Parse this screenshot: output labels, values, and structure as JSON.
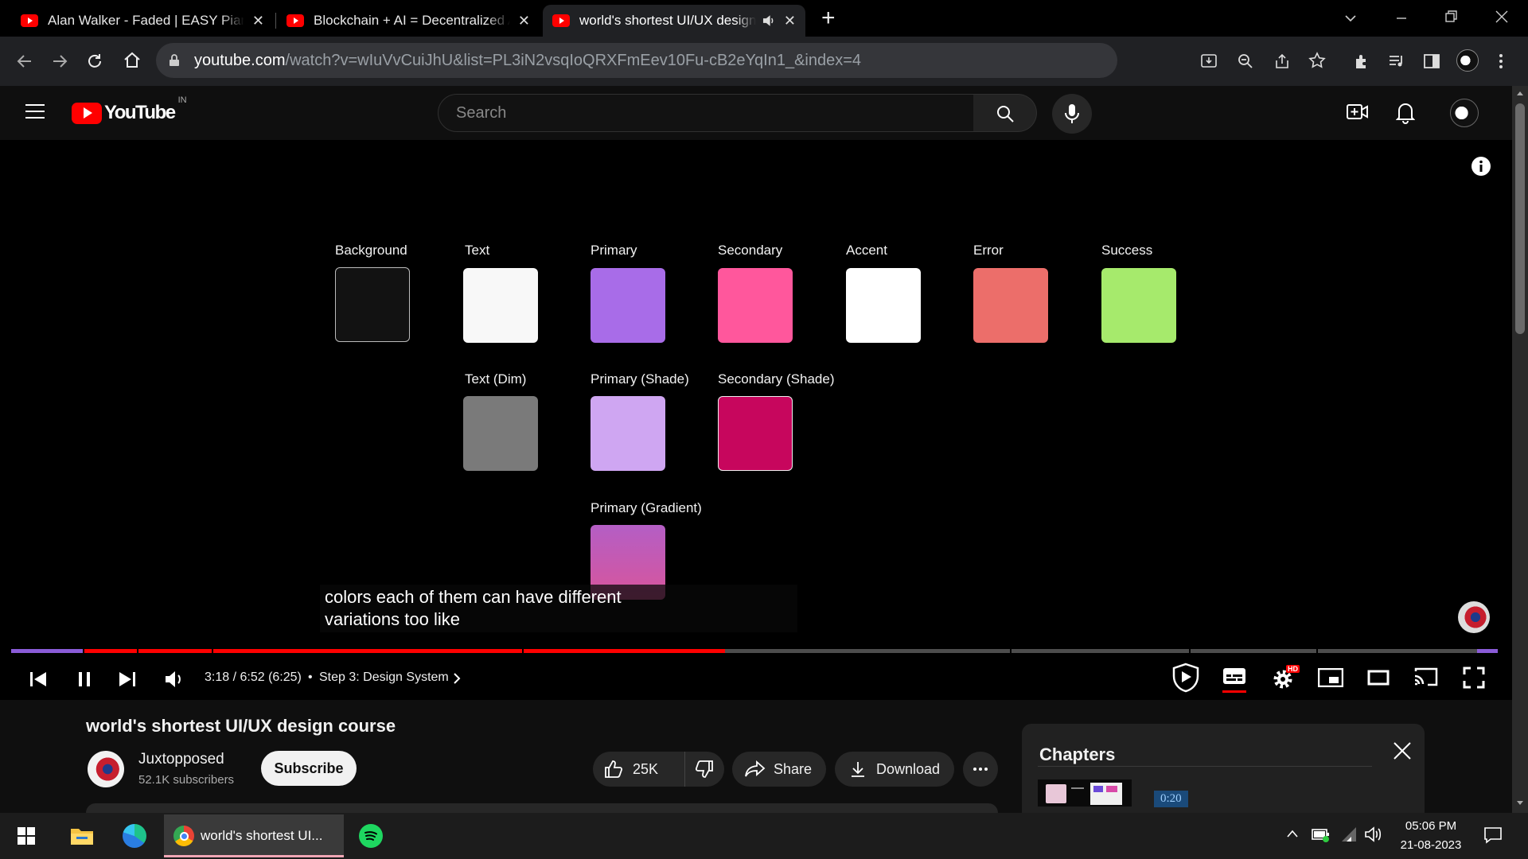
{
  "browser": {
    "tabs": [
      {
        "title": "Alan Walker - Faded | EASY Piano",
        "active": false
      },
      {
        "title": "Blockchain + AI = Decentralized AI",
        "active": false
      },
      {
        "title": "world's shortest UI/UX design course",
        "active": true
      }
    ],
    "new_tab": "+",
    "url_host": "youtube.com",
    "url_path": "/watch?v=wIuVvCuiJhU&list=PL3iN2vsqIoQRXFmEev10Fu-cB2eYqIn1_&index=4"
  },
  "youtube": {
    "logo_text": "YouTube",
    "region": "IN",
    "search_placeholder": "Search"
  },
  "video_frame": {
    "swatches_row1": [
      {
        "label": "Background",
        "color": "#121212"
      },
      {
        "label": "Text",
        "color": "#f8f8f8"
      },
      {
        "label": "Primary",
        "color": "#a86ce8"
      },
      {
        "label": "Secondary",
        "color": "#ff579c"
      },
      {
        "label": "Accent",
        "color": "#ffffff"
      },
      {
        "label": "Error",
        "color": "#ec6e6a"
      },
      {
        "label": "Success",
        "color": "#a6ea6c"
      }
    ],
    "swatches_row2": [
      {
        "label": "Text (Dim)",
        "color": "#7a7a7a"
      },
      {
        "label": "Primary (Shade)",
        "color": "#cfa6f2"
      },
      {
        "label": "Secondary (Shade)",
        "color": "#c7065d"
      }
    ],
    "swatches_row3": [
      {
        "label": "Primary (Gradient)",
        "color": "#d05aa8"
      }
    ],
    "caption_line1": "colors each of them can have different",
    "caption_line2": "variations too like"
  },
  "player": {
    "time": "3:18 / 6:52 (6:25)",
    "chapter": "Step 3: Design System",
    "progress_fraction": 0.48,
    "settings_badge": "HD"
  },
  "video_info": {
    "title": "world's shortest UI/UX design course",
    "channel": "Juxtopposed",
    "subscribers": "52.1K subscribers",
    "subscribe_label": "Subscribe",
    "likes": "25K",
    "share_label": "Share",
    "download_label": "Download"
  },
  "chapters_panel": {
    "title": "Chapters",
    "first_time": "0:20"
  },
  "taskbar": {
    "chrome_window_title": "world's shortest UI...",
    "time": "05:06 PM",
    "date": "21-08-2023"
  }
}
